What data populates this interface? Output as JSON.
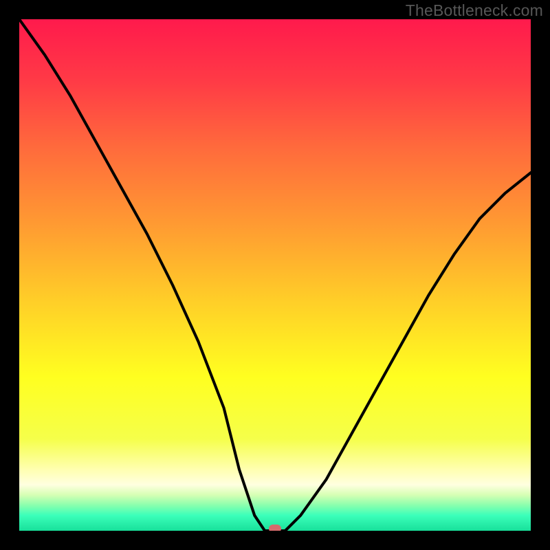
{
  "watermark": "TheBottleneck.com",
  "chart_data": {
    "type": "line",
    "title": "",
    "xlabel": "",
    "ylabel": "",
    "xlim": [
      0,
      100
    ],
    "ylim": [
      0,
      100
    ],
    "series": [
      {
        "name": "bottleneck-curve",
        "x": [
          0,
          5,
          10,
          15,
          20,
          25,
          30,
          35,
          40,
          43,
          46,
          48,
          52,
          55,
          60,
          65,
          70,
          75,
          80,
          85,
          90,
          95,
          100
        ],
        "y": [
          100,
          93,
          85,
          76,
          67,
          58,
          48,
          37,
          24,
          12,
          3,
          0,
          0,
          3,
          10,
          19,
          28,
          37,
          46,
          54,
          61,
          66,
          70
        ]
      }
    ],
    "marker": {
      "x": 50,
      "y": 0,
      "color": "#d46a6c"
    },
    "gradient_stops": [
      {
        "pos": 0.0,
        "color": "#ff1a4c"
      },
      {
        "pos": 0.12,
        "color": "#ff3a46"
      },
      {
        "pos": 0.25,
        "color": "#ff6a3c"
      },
      {
        "pos": 0.4,
        "color": "#ff9a32"
      },
      {
        "pos": 0.55,
        "color": "#ffce28"
      },
      {
        "pos": 0.7,
        "color": "#ffff20"
      },
      {
        "pos": 0.82,
        "color": "#f5ff4a"
      },
      {
        "pos": 0.88,
        "color": "#ffffb0"
      },
      {
        "pos": 0.91,
        "color": "#ffffe0"
      },
      {
        "pos": 0.93,
        "color": "#d6ffb4"
      },
      {
        "pos": 0.95,
        "color": "#8affad"
      },
      {
        "pos": 0.97,
        "color": "#3bffba"
      },
      {
        "pos": 1.0,
        "color": "#18e09a"
      }
    ]
  }
}
